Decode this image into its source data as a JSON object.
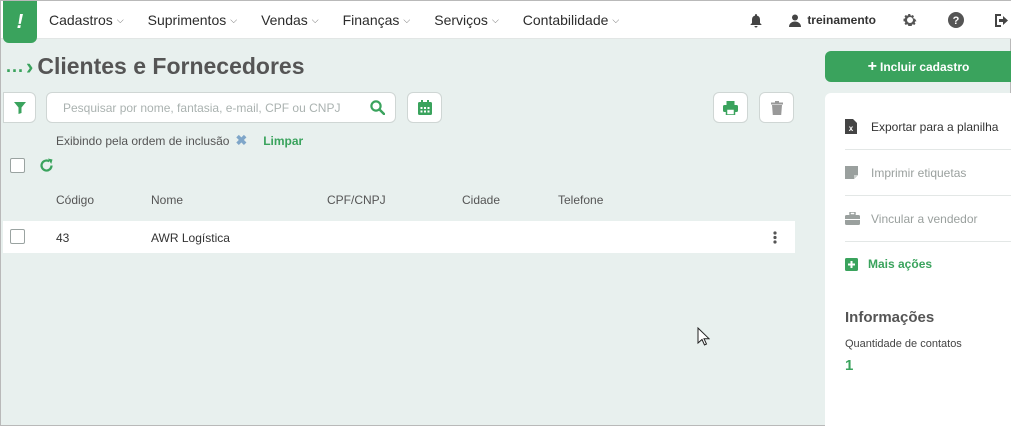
{
  "nav": {
    "items": [
      {
        "label": "Cadastros"
      },
      {
        "label": "Suprimentos"
      },
      {
        "label": "Vendas"
      },
      {
        "label": "Finanças"
      },
      {
        "label": "Serviços"
      },
      {
        "label": "Contabilidade"
      }
    ],
    "user_name": "treinamento"
  },
  "breadcrumb": {
    "ellipsis": "..."
  },
  "page": {
    "title": "Clientes e Fornecedores"
  },
  "search": {
    "placeholder": "Pesquisar por nome, fantasia, e-mail, CPF ou CNPJ"
  },
  "filter_info": {
    "order_text": "Exibindo pela ordem de inclusão",
    "clear_label": "Limpar"
  },
  "table": {
    "columns": [
      "Código",
      "Nome",
      "CPF/CNPJ",
      "Cidade",
      "Telefone"
    ],
    "rows": [
      {
        "codigo": "43",
        "nome": "AWR Logística",
        "cpf_cnpj": "",
        "cidade": "",
        "telefone": ""
      }
    ]
  },
  "sidebar": {
    "include_label": "Incluir cadastro",
    "actions": [
      {
        "label": "Exportar para a planilha",
        "enabled": true
      },
      {
        "label": "Imprimir etiquetas",
        "enabled": false
      },
      {
        "label": "Vincular a vendedor",
        "enabled": false
      }
    ],
    "more_label": "Mais ações",
    "info_title": "Informações",
    "contacts_label": "Quantidade de contatos",
    "contacts_value": "1"
  },
  "colors": {
    "accent": "#3aa35d",
    "background": "#e8f0ee"
  }
}
